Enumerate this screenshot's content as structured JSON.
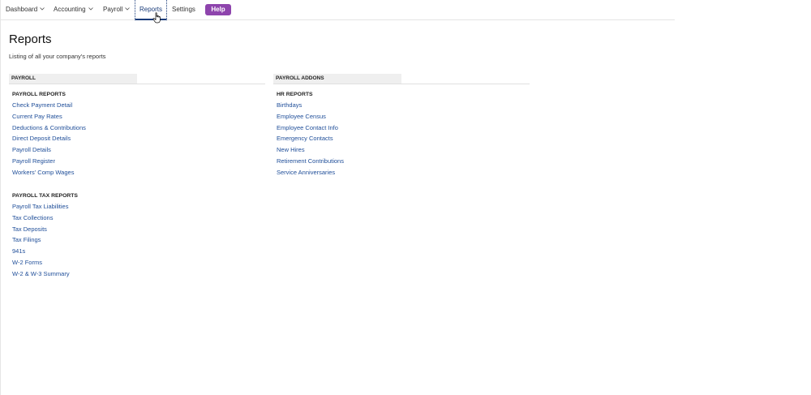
{
  "nav": {
    "items": [
      {
        "id": "nav-dashboard",
        "label": "Dashboard",
        "has_dropdown": true
      },
      {
        "id": "nav-accounting",
        "label": "Accounting",
        "has_dropdown": true
      },
      {
        "id": "nav-payroll",
        "label": "Payroll",
        "has_dropdown": true
      },
      {
        "id": "nav-reports",
        "label": "Reports",
        "has_dropdown": false,
        "active": true
      },
      {
        "id": "nav-settings",
        "label": "Settings",
        "has_dropdown": false
      }
    ],
    "help_label": "Help",
    "help_color": "#8e44ad",
    "active_color": "#1a3c7a"
  },
  "page": {
    "title": "Reports",
    "subtitle": "Listing of all your company's reports"
  },
  "sections": [
    {
      "header": "PAYROLL",
      "groups": [
        {
          "title": "PAYROLL REPORTS",
          "links": [
            "Check Payment Detail",
            "Current Pay Rates",
            "Deductions & Contributions",
            "Direct Deposit Details",
            "Payroll Details",
            "Payroll Register",
            "Workers' Comp Wages"
          ]
        },
        {
          "title": "PAYROLL TAX REPORTS",
          "links": [
            "Payroll Tax Liabilities",
            "Tax Collections",
            "Tax Deposits",
            "Tax Filings",
            "941s",
            "W-2 Forms",
            "W-2 & W-3 Summary"
          ]
        }
      ]
    },
    {
      "header": "PAYROLL ADDONS",
      "groups": [
        {
          "title": "HR REPORTS",
          "links": [
            "Birthdays",
            "Employee Census",
            "Employee Contact Info",
            "Emergency Contacts",
            "New Hires",
            "Retirement Contributions",
            "Service Anniversaries"
          ]
        }
      ]
    }
  ],
  "colors": {
    "link": "#1f4e99",
    "section_header_bg": "#efefef"
  }
}
